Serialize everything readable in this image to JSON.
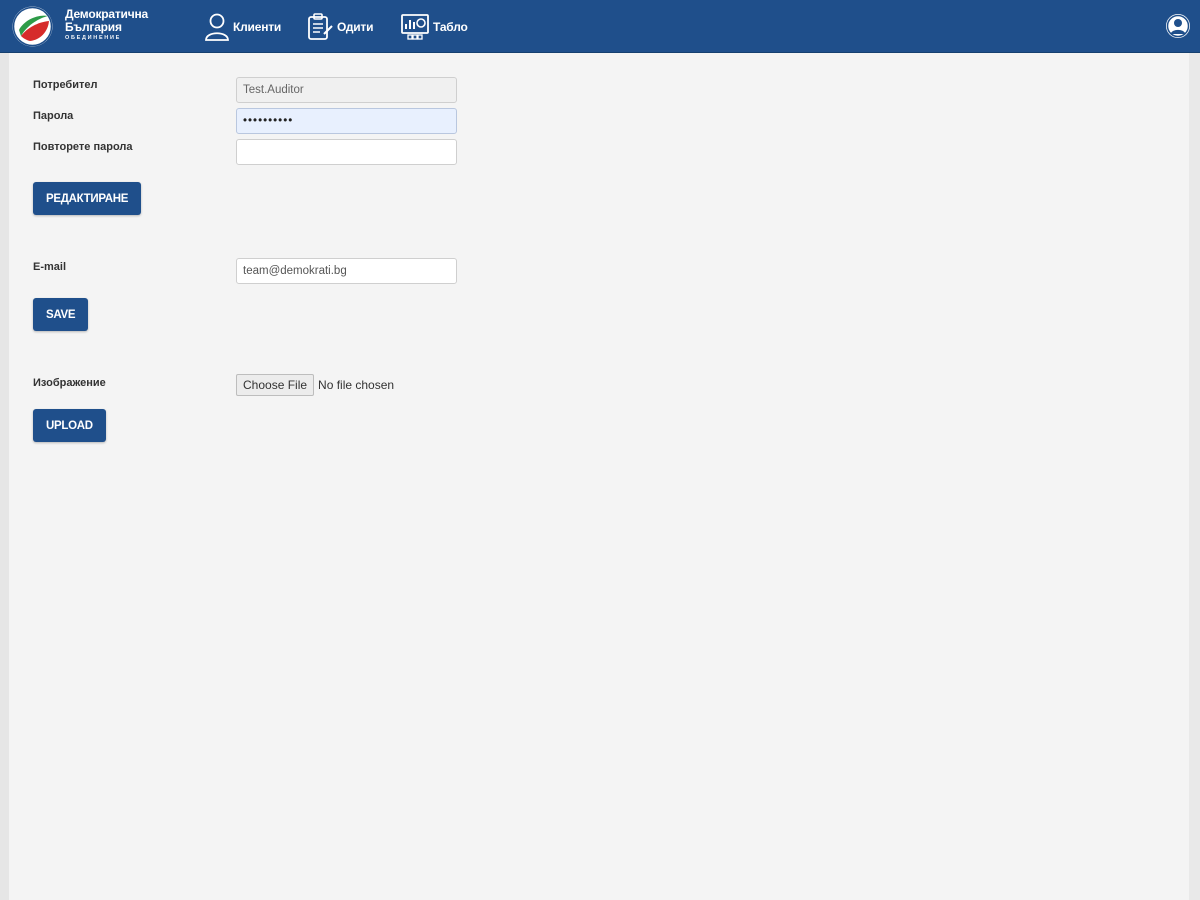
{
  "brand": {
    "line1": "Демократична",
    "line2": "България",
    "subline": "ОБЕДИНЕНИЕ",
    "colors": [
      "#ffffff",
      "#2e9b48",
      "#d62b2b"
    ]
  },
  "nav": {
    "clients": "Клиенти",
    "audits": "Одити",
    "dashboard": "Табло"
  },
  "profile_icon": "user-circle-icon",
  "account": {
    "username_label": "Потребител",
    "username_value": "Test.Auditor",
    "password_label": "Парола",
    "password_value": "••••••••••",
    "repeat_password_label": "Повторете парола",
    "repeat_password_value": "",
    "edit_button": "РЕДАКТИРАНЕ"
  },
  "email": {
    "label": "E-mail",
    "value": "team@demokrati.bg",
    "save_button": "SAVE"
  },
  "image": {
    "label": "Изображение",
    "choose_button": "Choose File",
    "file_status": "No file chosen",
    "upload_button": "UPLOAD"
  },
  "colors": {
    "accent": "#1f4f8b",
    "background": "#f4f4f4"
  }
}
